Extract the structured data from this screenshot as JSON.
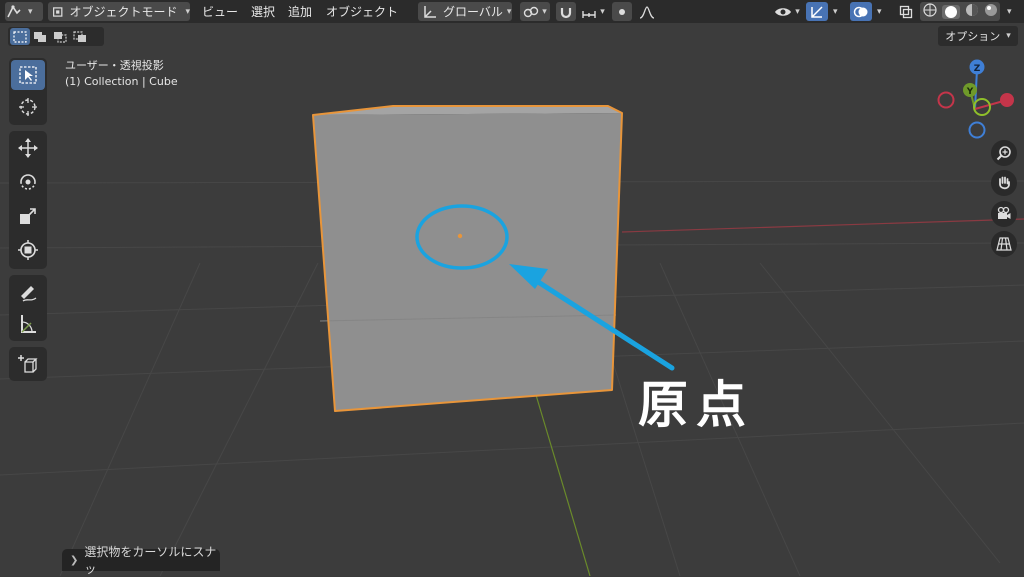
{
  "header": {
    "mode_label": "オブジェクトモード",
    "menus": [
      "ビュー",
      "選択",
      "追加",
      "オブジェクト"
    ],
    "transform_orientation": "グローバル"
  },
  "options_label": "オプション",
  "viewport_info": {
    "view_name": "ユーザー・透視投影",
    "collection": "(1) Collection | Cube"
  },
  "gizmo": {
    "z": "Z",
    "y": "Y"
  },
  "annotation": {
    "label": "原点",
    "color": "#1aa3e0"
  },
  "status": {
    "text": "選択物をカーソルにスナッ"
  },
  "colors": {
    "selection_outline": "#e8953a",
    "header_bg": "#2b2b2b",
    "active_tool": "#4b6e9c"
  }
}
